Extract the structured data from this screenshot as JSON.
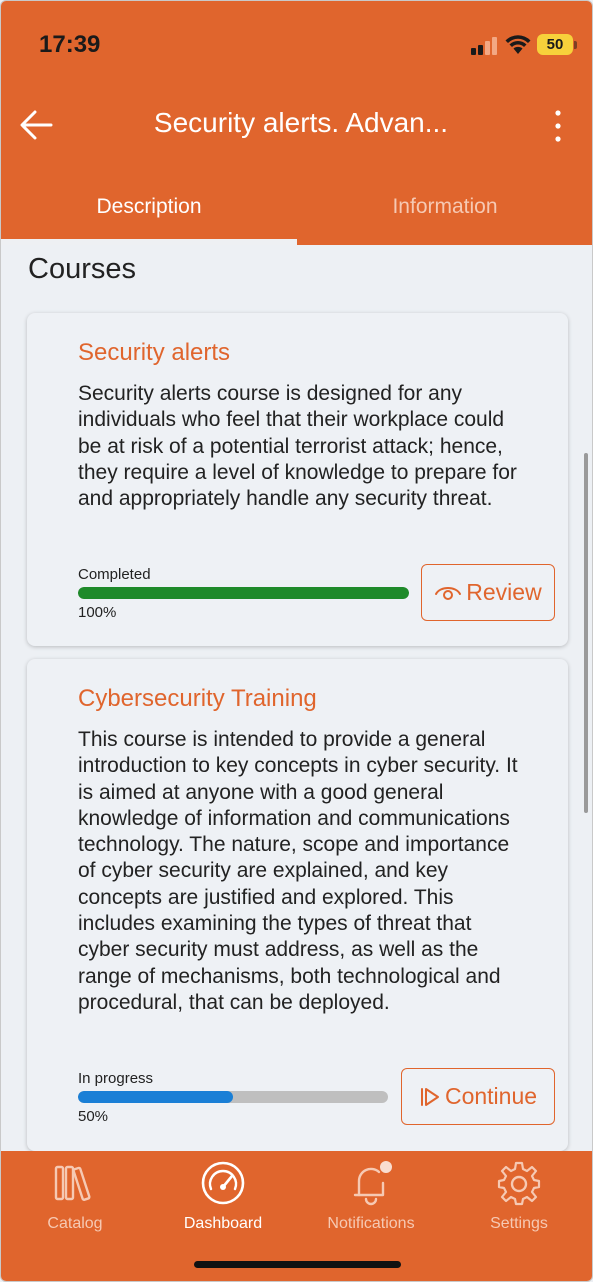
{
  "status_bar": {
    "time": "17:39",
    "battery": "50"
  },
  "appbar": {
    "title": "Security alerts. Advan...",
    "back_icon": "arrow-left-icon",
    "menu_icon": "more-vertical-icon"
  },
  "tabs": [
    {
      "label": "Description",
      "active": true
    },
    {
      "label": "Information",
      "active": false
    }
  ],
  "section": {
    "title": "Courses"
  },
  "courses": [
    {
      "title": "Security alerts",
      "description": "Security alerts course is designed for any individuals who feel that their workplace could be at risk of a potential terrorist attack; hence, they require a level of knowledge to prepare for and appropriately handle any security threat.",
      "status": "Completed",
      "progress_percent": 100,
      "progress_label": "100%",
      "progress_color": "#1e8a2a",
      "action_label": "Review",
      "action_icon": "eye-icon"
    },
    {
      "title": "Cybersecurity Training",
      "description": "This course is intended to provide a general introduction to key concepts in cyber security. It is aimed at anyone with a good general knowledge of information and communications technology. The nature, scope and importance of cyber security are explained, and key concepts are justified and explored. This includes examining the types of threat that cyber security must address, as well as the range of mechanisms, both technological and procedural, that can be deployed.",
      "status": "In progress",
      "progress_percent": 50,
      "progress_label": "50%",
      "progress_color": "#1a7fd6",
      "action_label": "Continue",
      "action_icon": "play-outline-icon"
    }
  ],
  "bottom_nav": [
    {
      "label": "Catalog",
      "icon": "books-icon",
      "active": false
    },
    {
      "label": "Dashboard",
      "icon": "speedometer-icon",
      "active": true
    },
    {
      "label": "Notifications",
      "icon": "bell-icon",
      "active": false,
      "badge": true
    },
    {
      "label": "Settings",
      "icon": "gear-icon",
      "active": false
    }
  ],
  "colors": {
    "brand": "#e0652d",
    "background": "#edf0f4"
  }
}
